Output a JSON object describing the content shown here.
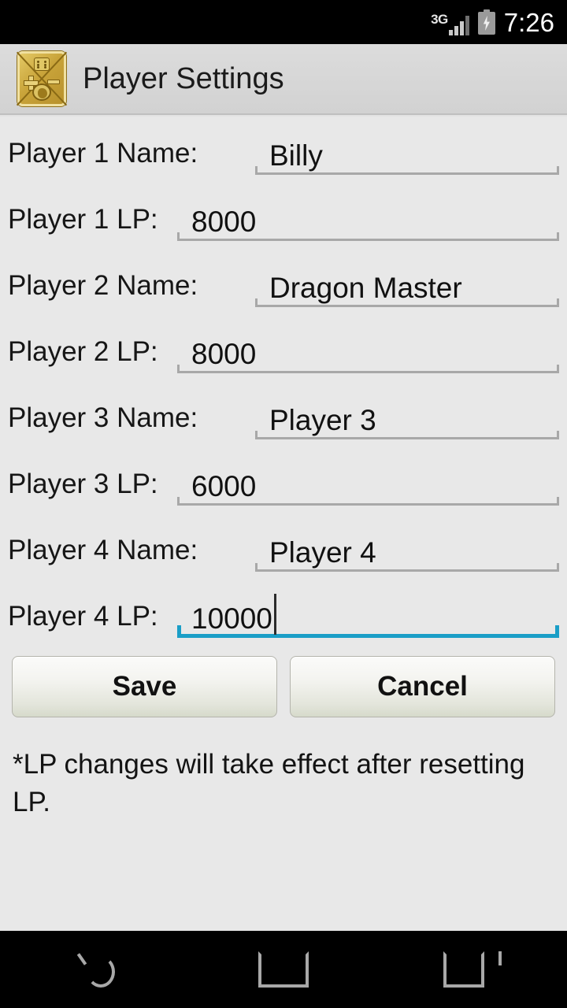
{
  "status_bar": {
    "network_type": "3G",
    "network_icon": "signal-bars-icon",
    "battery_icon": "battery-charging-icon",
    "clock": "7:26"
  },
  "action_bar": {
    "app_icon": "game-counter-app-icon",
    "title": "Player Settings"
  },
  "form": {
    "fields": [
      {
        "label": "Player 1 Name:",
        "value": "Billy",
        "type": "name",
        "focused": false
      },
      {
        "label": "Player 1 LP:",
        "value": "8000",
        "type": "lp",
        "focused": false
      },
      {
        "label": "Player 2 Name:",
        "value": "Dragon Master",
        "type": "name",
        "focused": false
      },
      {
        "label": "Player 2 LP:",
        "value": "8000",
        "type": "lp",
        "focused": false
      },
      {
        "label": "Player 3 Name:",
        "value": "Player 3",
        "type": "name",
        "focused": false
      },
      {
        "label": "Player 3 LP:",
        "value": "6000",
        "type": "lp",
        "focused": false
      },
      {
        "label": "Player 4 Name:",
        "value": "Player 4",
        "type": "name",
        "focused": false
      },
      {
        "label": "Player 4 LP:",
        "value": "10000",
        "type": "lp",
        "focused": true
      }
    ]
  },
  "buttons": {
    "save_label": "Save",
    "cancel_label": "Cancel"
  },
  "note": "*LP changes will take effect after resetting LP.",
  "nav_bar": {
    "back_icon": "back-arrow-icon",
    "home_icon": "home-square-icon",
    "recents_icon": "recents-icon"
  },
  "colors": {
    "accent_focus": "#1a9ec7",
    "background": "#e8e8e8",
    "action_bar": "#d6d6d6",
    "underline": "#a8a8a8",
    "text": "#161616"
  }
}
